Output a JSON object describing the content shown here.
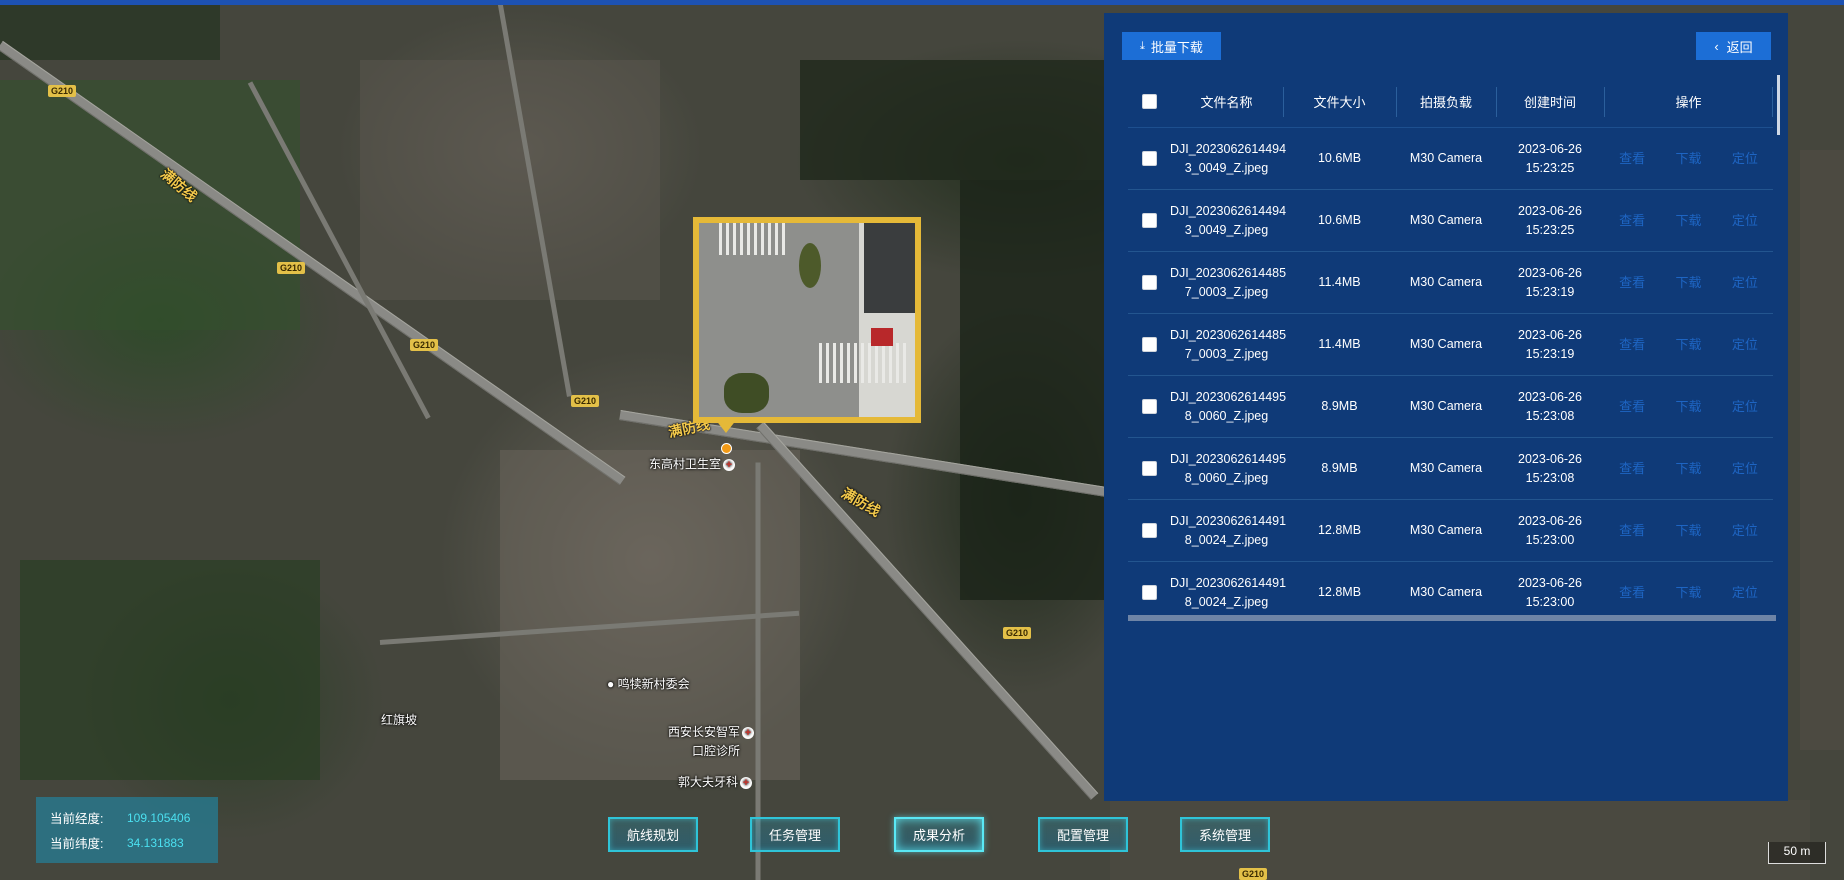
{
  "map": {
    "road_labels": [
      "G210",
      "G210",
      "G210",
      "G210",
      "G210",
      "G210"
    ],
    "road_names": [
      "满防线",
      "满防线",
      "满防线"
    ],
    "pois": [
      {
        "name": "东高村卫生室",
        "has_cross": true
      },
      {
        "name": "鸣犊新村委会",
        "has_cross": false
      },
      {
        "name": "红旗坡",
        "has_cross": false
      },
      {
        "name": "西安长安智军",
        "has_cross": true
      },
      {
        "name": "口腔诊所",
        "has_cross": false
      },
      {
        "name": "郭大夫牙科",
        "has_cross": true
      }
    ],
    "scale": "50 m"
  },
  "result_panel": {
    "batch_download_label": "批量下载",
    "back_label": "返回",
    "columns": {
      "name": "文件名称",
      "size": "文件大小",
      "payload": "拍摄负载",
      "created": "创建时间",
      "ops": "操作"
    },
    "rows": [
      {
        "name1": "DJI_2023062614494",
        "name2": "3_0049_Z.jpeg",
        "size": "10.6MB",
        "payload": "M30 Camera",
        "date": "2023-06-26",
        "time": "15:23:25"
      },
      {
        "name1": "DJI_2023062614494",
        "name2": "3_0049_Z.jpeg",
        "size": "10.6MB",
        "payload": "M30 Camera",
        "date": "2023-06-26",
        "time": "15:23:25"
      },
      {
        "name1": "DJI_2023062614485",
        "name2": "7_0003_Z.jpeg",
        "size": "11.4MB",
        "payload": "M30 Camera",
        "date": "2023-06-26",
        "time": "15:23:19"
      },
      {
        "name1": "DJI_2023062614485",
        "name2": "7_0003_Z.jpeg",
        "size": "11.4MB",
        "payload": "M30 Camera",
        "date": "2023-06-26",
        "time": "15:23:19"
      },
      {
        "name1": "DJI_2023062614495",
        "name2": "8_0060_Z.jpeg",
        "size": "8.9MB",
        "payload": "M30 Camera",
        "date": "2023-06-26",
        "time": "15:23:08"
      },
      {
        "name1": "DJI_2023062614495",
        "name2": "8_0060_Z.jpeg",
        "size": "8.9MB",
        "payload": "M30 Camera",
        "date": "2023-06-26",
        "time": "15:23:08"
      },
      {
        "name1": "DJI_2023062614491",
        "name2": "8_0024_Z.jpeg",
        "size": "12.8MB",
        "payload": "M30 Camera",
        "date": "2023-06-26",
        "time": "15:23:00"
      },
      {
        "name1": "DJI_2023062614491",
        "name2": "8_0024_Z.jpeg",
        "size": "12.8MB",
        "payload": "M30 Camera",
        "date": "2023-06-26",
        "time": "15:23:00"
      }
    ],
    "ops": {
      "view": "查看",
      "download": "下载",
      "locate": "定位"
    }
  },
  "coords": {
    "lng_label": "当前经度:",
    "lng_value": "109.105406",
    "lat_label": "当前纬度:",
    "lat_value": "34.131883"
  },
  "nav": {
    "items": [
      "航线规划",
      "任务管理",
      "成果分析",
      "配置管理",
      "系统管理"
    ],
    "active": "成果分析"
  },
  "colors": {
    "panel_bg": "#0f3a78",
    "button_blue": "#1c6ed6",
    "link_blue": "#1e65c3",
    "marker_gold": "#e5b938",
    "coord_value": "#4be0f0",
    "nav_border": "#2fc4d8"
  }
}
